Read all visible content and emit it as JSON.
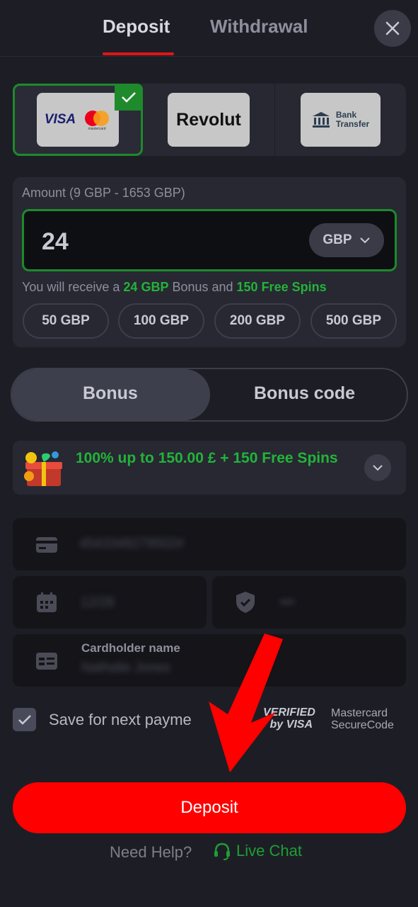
{
  "header": {
    "tabs": [
      {
        "label": "Deposit",
        "active": true
      },
      {
        "label": "Withdrawal",
        "active": false
      }
    ],
    "close_icon": "close-icon"
  },
  "payment_methods": [
    {
      "id": "visa-mastercard",
      "visa_label": "VISA",
      "mastercard_label": "mastercard",
      "selected": true
    },
    {
      "id": "revolut",
      "label": "Revolut",
      "selected": false
    },
    {
      "id": "bank-transfer",
      "label_line1": "Bank",
      "label_line2": "Transfer",
      "selected": false
    }
  ],
  "amount": {
    "label": "Amount (9 GBP - 1653 GBP)",
    "value": "24",
    "currency": "GBP",
    "receive_prefix": "You will receive a ",
    "receive_bonus": "24 GBP",
    "receive_middle": " Bonus and ",
    "receive_spins": "150 Free Spins",
    "presets": [
      "50 GBP",
      "100 GBP",
      "200 GBP",
      "500 GBP"
    ]
  },
  "bonus_toggle": {
    "options": [
      "Bonus",
      "Bonus code"
    ],
    "active": "Bonus"
  },
  "offer": {
    "text": "100% up to 150.00 £ + 150 Free Spins"
  },
  "card_form": {
    "card_number": "4543348279502#",
    "expiry": "12/28",
    "cvv": "•••",
    "cardholder_label": "Cardholder name",
    "cardholder_value": "Nathalie Jones"
  },
  "save": {
    "label": "Save for next payme",
    "checked": true
  },
  "security_badges": {
    "verified_line1": "VERIFIED",
    "verified_line2": "by VISA",
    "mastercard_line1": "Mastercard",
    "mastercard_line2": "SecureCode"
  },
  "deposit_button": "Deposit",
  "help": {
    "question": "Need Help?",
    "live_chat": "Live Chat"
  },
  "colors": {
    "background": "#1d1e25",
    "panel": "#272832",
    "accent_red": "#ff0000",
    "accent_green": "#23b33a"
  }
}
